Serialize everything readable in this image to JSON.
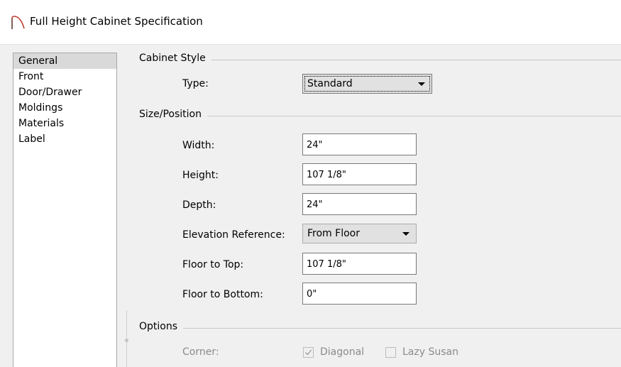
{
  "window": {
    "title": "Full Height Cabinet Specification",
    "icon": "arch-icon",
    "accent_color": "#c0392b"
  },
  "sidebar": {
    "items": [
      {
        "label": "General",
        "selected": true
      },
      {
        "label": "Front"
      },
      {
        "label": "Door/Drawer"
      },
      {
        "label": "Moldings"
      },
      {
        "label": "Materials"
      },
      {
        "label": "Label"
      }
    ]
  },
  "cabinet_style": {
    "group_title": "Cabinet Style",
    "type_label": "Type:",
    "type_value": "Standard"
  },
  "size_position": {
    "group_title": "Size/Position",
    "width_label": "Width:",
    "width_value": "24\"",
    "height_label": "Height:",
    "height_value": "107 1/8\"",
    "depth_label": "Depth:",
    "depth_value": "24\"",
    "elevation_label": "Elevation Reference:",
    "elevation_value": "From Floor",
    "floor_to_top_label": "Floor to Top:",
    "floor_to_top_value": "107 1/8\"",
    "floor_to_bottom_label": "Floor to Bottom:",
    "floor_to_bottom_value": "0\""
  },
  "options": {
    "group_title": "Options",
    "corner_label": "Corner:",
    "diagonal_label": "Diagonal",
    "diagonal_checked": true,
    "lazy_susan_label": "Lazy Susan",
    "lazy_susan_checked": false
  }
}
